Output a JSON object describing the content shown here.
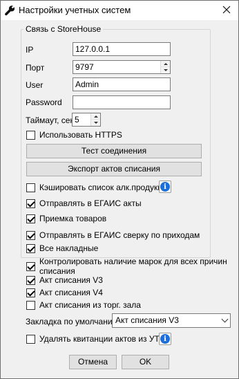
{
  "window": {
    "title": "Настройки учетных систем"
  },
  "group": {
    "title": "Связь с StoreHouse"
  },
  "connection": {
    "ip_label": "IP",
    "ip_value": "127.0.0.1",
    "port_label": "Порт",
    "port_value": "9797",
    "user_label": "User",
    "user_value": "Admin",
    "password_label": "Password",
    "password_value": "",
    "timeout_label": "Таймаут, сек",
    "timeout_value": "5"
  },
  "https": {
    "label": "Использовать HTTPS",
    "checked": false
  },
  "buttons": {
    "test": "Тест соединения",
    "export": "Экспорт актов списания",
    "cancel": "Отмена",
    "ok": "OK"
  },
  "options_group": [
    {
      "label": "Кэшировать список алк.продукции",
      "checked": false
    },
    {
      "label": "Отправлять в ЕГАИС акты",
      "checked": true
    },
    {
      "label": "Приемка товаров",
      "checked": true
    },
    {
      "label": "Отправлять в ЕГАИС сверку по приходам",
      "checked": true
    },
    {
      "label": "Все накладные",
      "checked": true
    }
  ],
  "options_main": [
    {
      "label": "Контролировать наличие марок для всех причин списания",
      "checked": true
    },
    {
      "label": "Акт списания V3",
      "checked": true
    },
    {
      "label": "Акт списания V4",
      "checked": true
    },
    {
      "label": "Акт списания из торг. зала",
      "checked": false
    }
  ],
  "default_tab": {
    "label": "Закладка по умолчанию",
    "value": "Акт списания V3"
  },
  "delete_receipts": {
    "label": "Удалять квитанции актов из УТМ",
    "checked": false
  },
  "colors": {
    "info_blue": "#1e6fd9",
    "dialog_bg": "#f0f0f0"
  }
}
